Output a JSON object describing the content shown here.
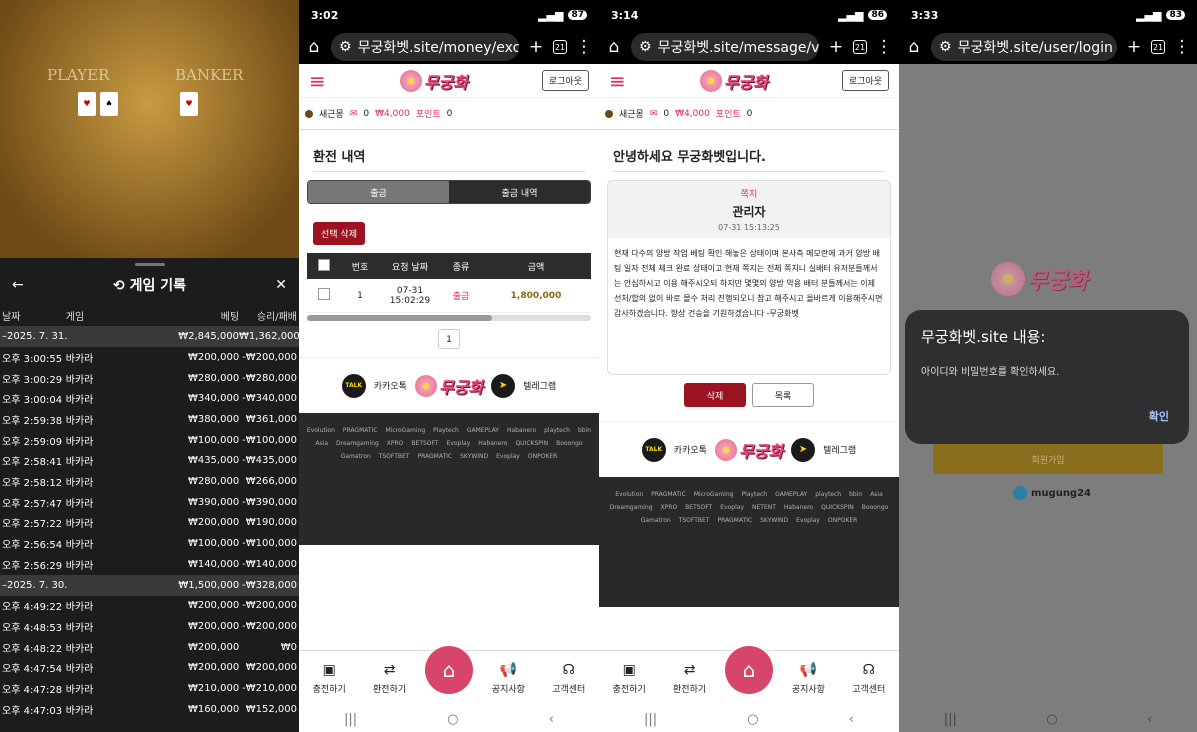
{
  "p1": {
    "table_labels": {
      "player": "PLAYER",
      "banker": "BANKER"
    },
    "sheet_title": "게임 기록",
    "columns": [
      "날짜",
      "게임",
      "베팅",
      "승리/패배"
    ],
    "groups": [
      {
        "date": "–2025. 7. 31.",
        "bet": "₩2,845,000",
        "result": "₩1,362,000",
        "rows": [
          [
            "오후 3:00:55",
            "바카라",
            "₩200,000",
            "-₩200,000"
          ],
          [
            "오후 3:00:29",
            "바카라",
            "₩280,000",
            "-₩280,000"
          ],
          [
            "오후 3:00:04",
            "바카라",
            "₩340,000",
            "-₩340,000"
          ],
          [
            "오후 2:59:38",
            "바카라",
            "₩380,000",
            "₩361,000"
          ],
          [
            "오후 2:59:09",
            "바카라",
            "₩100,000",
            "-₩100,000"
          ],
          [
            "오후 2:58:41",
            "바카라",
            "₩435,000",
            "-₩435,000"
          ],
          [
            "오후 2:58:12",
            "바카라",
            "₩280,000",
            "₩266,000"
          ],
          [
            "오후 2:57:47",
            "바카라",
            "₩390,000",
            "-₩390,000"
          ],
          [
            "오후 2:57:22",
            "바카라",
            "₩200,000",
            "₩190,000"
          ],
          [
            "오후 2:56:54",
            "바카라",
            "₩100,000",
            "-₩100,000"
          ],
          [
            "오후 2:56:29",
            "바카라",
            "₩140,000",
            "-₩140,000"
          ]
        ]
      },
      {
        "date": "–2025. 7. 30.",
        "bet": "₩1,500,000",
        "result": "-₩328,000",
        "rows": [
          [
            "오후 4:49:22",
            "바카라",
            "₩200,000",
            "-₩200,000"
          ],
          [
            "오후 4:48:53",
            "바카라",
            "₩200,000",
            "-₩200,000"
          ],
          [
            "오후 4:48:22",
            "바카라",
            "₩200,000",
            "₩0"
          ],
          [
            "오후 4:47:54",
            "바카라",
            "₩200,000",
            "₩200,000"
          ],
          [
            "오후 4:47:28",
            "바카라",
            "₩210,000",
            "-₩210,000"
          ],
          [
            "오후 4:47:03",
            "바카라",
            "₩160,000",
            "₩152,000"
          ]
        ]
      }
    ]
  },
  "p2": {
    "status": {
      "time": "3:02",
      "battery": "87"
    },
    "url": "무궁화벳.site/money/exch",
    "tabs": "21",
    "logo": "무궁화",
    "logout": "로그아웃",
    "user": {
      "name": "새근몽",
      "msgs": "0",
      "money": "₩4,000",
      "points_label": "포인트",
      "points": "0"
    },
    "title": "환전 내역",
    "seg": [
      "출금",
      "출금 내역"
    ],
    "delete_selected": "선택 삭제",
    "table_head": [
      "번호",
      "요청 날짜",
      "종류",
      "금액"
    ],
    "row": {
      "no": "1",
      "date": "07-31",
      "time": "15:02:29",
      "type": "출금",
      "amount": "1,800,000"
    },
    "page": "1",
    "kakao": "카카오톡",
    "telegram": "텔레그램",
    "talk_badge": "TALK",
    "providers": [
      "Evolution",
      "PRAGMATIC",
      "MicroGaming",
      "Playtech",
      "GAMEPLAY",
      "Habanero",
      "playtech",
      "bbin",
      "Asia",
      "Dreamgaming",
      "XPRO",
      "BETSOFT",
      "Evoplay",
      "Habanero",
      "QUICKSPIN",
      "Booongo",
      "Gamatron",
      "TSOFTBET",
      "PRAGMATIC",
      "SKYWIND",
      "Evoplay",
      "ONPOKER"
    ]
  },
  "p3": {
    "status": {
      "time": "3:14",
      "battery": "86"
    },
    "url": "무궁화벳.site/message/vie",
    "tabs": "21",
    "logo": "무궁화",
    "logout": "로그아웃",
    "user": {
      "name": "새근몽",
      "msgs": "0",
      "money": "₩4,000",
      "points_label": "포인트",
      "points": "0"
    },
    "title": "안녕하세요 무궁화벳입니다.",
    "tag": "쪽지",
    "from": "관리자",
    "time": "07-31 15:13:25",
    "body": "현재 다수의 양방 작업 베팅 확인 해놓은 상태이며 본사측 메모란에 과거 양방 배팅 일자 전체 체크 완료 상태이고 현재 쪽지는 전체 쪽지니 실배터 유저분들께서는 안심하시고 이용 해주시오되 하지만 몇몇의 양방 악용 배터 분들께서는 이제 선처/합의 없이 바로 몰수 처리 진행되오니 참고 해주시고 올바르게 이용해주시면 감사하겠습니다. 항상 건승을 기원하겠습니다 -무궁화벳",
    "delete": "삭제",
    "list": "목록",
    "kakao": "카카오톡",
    "telegram": "텔레그램",
    "talk_badge": "TALK",
    "providers": [
      "Evolution",
      "PRAGMATIC",
      "MicroGaming",
      "Playtech",
      "GAMEPLAY",
      "playtech",
      "bbin",
      "Asia",
      "Dreamgaming",
      "XPRO",
      "BETSOFT",
      "Evoplay",
      "NETENT",
      "Habanero",
      "QUICKSPIN",
      "Booongo",
      "Gamatron",
      "TSOFTBET",
      "PRAGMATIC",
      "SKYWIND",
      "Evoplay",
      "ONPOKER"
    ]
  },
  "p4": {
    "status": {
      "time": "3:33",
      "battery": "83"
    },
    "url": "무궁화벳.site/user/login",
    "tabs": "21",
    "logo": "무궁화",
    "dialog_title": "무궁화벳.site 내용:",
    "dialog_msg": "아이디와 비밀번호를 확인하세요.",
    "dialog_ok": "확인",
    "signup": "회원가입",
    "brand": "mugung24"
  },
  "nav": [
    "충전하기",
    "환전하기",
    "공지사항",
    "고객센터"
  ]
}
